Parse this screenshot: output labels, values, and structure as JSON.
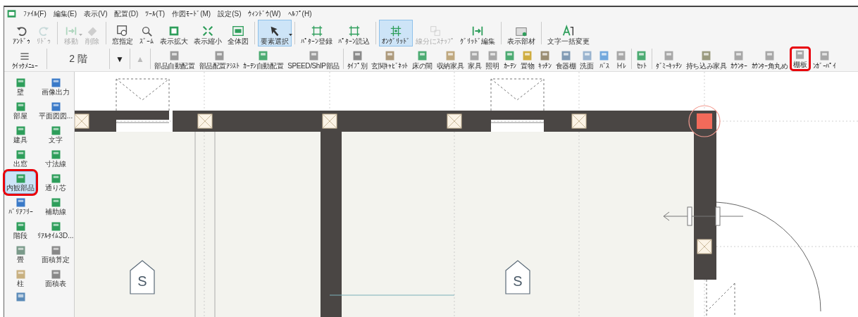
{
  "menu": [
    "ﾌｧｲﾙ(F)",
    "編集(E)",
    "表示(V)",
    "配置(D)",
    "ﾂｰﾙ(T)",
    "作図ﾓｰﾄﾞ(M)",
    "設定(S)",
    "ｳｨﾝﾄﾞｳ(W)",
    "ﾍﾙﾌﾟ(H)"
  ],
  "toolbar": {
    "groups": [
      [
        {
          "label": "ｱﾝﾄﾞｩ",
          "disabled": false,
          "selected": false,
          "dropdown": false
        },
        {
          "label": "ﾘﾄﾞｩ",
          "disabled": true,
          "selected": false,
          "dropdown": false
        }
      ],
      [
        {
          "label": "移動",
          "disabled": true,
          "selected": false,
          "dropdown": true
        },
        {
          "label": "削除",
          "disabled": true,
          "selected": false,
          "dropdown": false
        }
      ],
      [
        {
          "label": "窓指定",
          "disabled": false,
          "selected": false,
          "dropdown": false
        },
        {
          "label": "ｽﾞｰﾑ",
          "disabled": false,
          "selected": false,
          "dropdown": false
        },
        {
          "label": "表示拡大",
          "disabled": false,
          "selected": false,
          "dropdown": false
        },
        {
          "label": "表示縮小",
          "disabled": false,
          "selected": false,
          "dropdown": false
        },
        {
          "label": "全体図",
          "disabled": false,
          "selected": false,
          "dropdown": false
        }
      ],
      [
        {
          "label": "要素選択",
          "disabled": false,
          "selected": true,
          "dropdown": true
        }
      ],
      [
        {
          "label": "ﾊﾟﾀｰﾝ登録",
          "disabled": false,
          "selected": false,
          "dropdown": false
        },
        {
          "label": "ﾊﾟﾀｰﾝ読込",
          "disabled": false,
          "selected": false,
          "dropdown": false
        }
      ],
      [
        {
          "label": "ｵﾝｸﾞﾘｯﾄﾞ",
          "disabled": false,
          "selected": true,
          "dropdown": false
        },
        {
          "label": "線分にｽﾅｯﾌﾟ",
          "disabled": true,
          "selected": false,
          "dropdown": false
        },
        {
          "label": "ｸﾞﾘｯﾄﾞ編集",
          "disabled": false,
          "selected": false,
          "dropdown": false
        }
      ],
      [
        {
          "label": "表示部材",
          "disabled": false,
          "selected": false,
          "dropdown": false
        }
      ],
      [
        {
          "label": "文字一括変更",
          "disabled": false,
          "selected": false,
          "dropdown": false
        }
      ]
    ]
  },
  "toolbar2": {
    "quick_menu": "ｸｲｯｸﾒﾆｭｰ",
    "floor": "2 階",
    "floor_down": {
      "label": "▼",
      "disabled": false
    },
    "floor_up": {
      "label": "▲",
      "disabled": true
    },
    "groups": [
      [
        {
          "label": "部品自動配置",
          "highlighted": false
        },
        {
          "label": "部品配置ｱｼｽﾄ",
          "highlighted": false
        },
        {
          "label": "ｶｰﾃﾝ自動配置",
          "highlighted": false
        },
        {
          "label": "SPEED/ShIP部品",
          "highlighted": false
        }
      ],
      [
        {
          "label": "ﾀｲﾌﾟ別",
          "highlighted": false
        },
        {
          "label": "玄関ｷｬﾋﾞﾈｯﾄ",
          "highlighted": false
        },
        {
          "label": "床の間",
          "highlighted": false
        },
        {
          "label": "収納家具",
          "highlighted": false
        },
        {
          "label": "家具",
          "highlighted": false
        },
        {
          "label": "照明",
          "highlighted": false
        },
        {
          "label": "ｶｰﾃﾝ",
          "highlighted": false
        },
        {
          "label": "置物",
          "highlighted": false
        },
        {
          "label": "ｷｯﾁﾝ",
          "highlighted": false
        },
        {
          "label": "食器棚",
          "highlighted": false
        },
        {
          "label": "洗面",
          "highlighted": false
        },
        {
          "label": "ﾊﾞｽ",
          "highlighted": false
        },
        {
          "label": "ﾄｲﾚ",
          "highlighted": false
        }
      ],
      [
        {
          "label": "ｾｯﾄ",
          "highlighted": false
        }
      ],
      [
        {
          "label": "ﾀﾞﾐｰｷｯﾁﾝ",
          "highlighted": false
        },
        {
          "label": "持ち込み家具",
          "highlighted": false
        },
        {
          "label": "ｶｳﾝﾀｰ",
          "highlighted": false
        },
        {
          "label": "ｶｳﾝﾀｰ角丸め",
          "highlighted": false
        },
        {
          "label": "棚板",
          "highlighted": true
        },
        {
          "label": "ﾝｶﾞｰﾊﾟｲ",
          "highlighted": false
        }
      ]
    ]
  },
  "side_panel": [
    {
      "label": "壁",
      "selected": false,
      "highlighted": false
    },
    {
      "label": "画像出力",
      "selected": false,
      "highlighted": false
    },
    {
      "label": "部屋",
      "selected": false,
      "highlighted": false
    },
    {
      "label": "平面図図...",
      "selected": false,
      "highlighted": false
    },
    {
      "label": "建具",
      "selected": false,
      "highlighted": false
    },
    {
      "label": "文字",
      "selected": false,
      "highlighted": false
    },
    {
      "label": "出窓",
      "selected": false,
      "highlighted": false
    },
    {
      "label": "寸法線",
      "selected": false,
      "highlighted": false
    },
    {
      "label": "内観部品",
      "selected": true,
      "highlighted": true
    },
    {
      "label": "通り芯",
      "selected": false,
      "highlighted": false
    },
    {
      "label": "ﾊﾞﾘｱﾌﾘｰ",
      "selected": false,
      "highlighted": false
    },
    {
      "label": "補助線",
      "selected": false,
      "highlighted": false
    },
    {
      "label": "階段",
      "selected": false,
      "highlighted": false
    },
    {
      "label": "ﾘｱﾙﾀｲﾑ3D...",
      "selected": false,
      "highlighted": false
    },
    {
      "label": "畳",
      "selected": false,
      "highlighted": false
    },
    {
      "label": "面積算定",
      "selected": false,
      "highlighted": false
    },
    {
      "label": "柱",
      "selected": false,
      "highlighted": false
    },
    {
      "label": "面積表",
      "selected": false,
      "highlighted": false
    }
  ],
  "plan": {
    "columns": [
      {
        "selected": false
      },
      {
        "selected": false
      },
      {
        "selected": false
      },
      {
        "selected": false
      },
      {
        "selected": false
      },
      {
        "selected": true
      },
      {
        "selected": false
      }
    ],
    "room_tags": [
      "S",
      "S"
    ]
  }
}
